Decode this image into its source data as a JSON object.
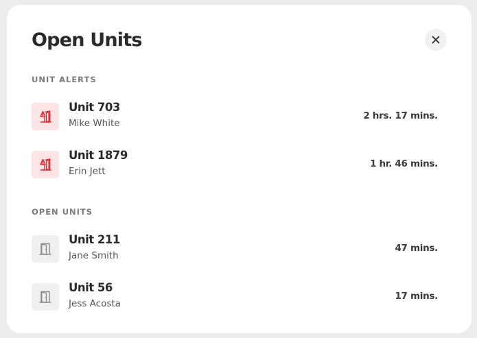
{
  "modal": {
    "title": "Open Units",
    "close_icon": "close-icon"
  },
  "sections": {
    "alerts": {
      "label": "UNIT ALERTS",
      "icon": "door-alert-icon",
      "accent_color": "#e0242e",
      "icon_background": "#fde3e3",
      "items": [
        {
          "unit": "Unit 703",
          "person": "Mike White",
          "duration": "2 hrs. 17 mins."
        },
        {
          "unit": "Unit 1879",
          "person": "Erin Jett",
          "duration": "1 hr. 46 mins."
        }
      ]
    },
    "open": {
      "label": "OPEN UNITS",
      "icon": "open-door-icon",
      "accent_color": "#8a8a8a",
      "icon_background": "#efefef",
      "items": [
        {
          "unit": "Unit 211",
          "person": "Jane Smith",
          "duration": "47 mins."
        },
        {
          "unit": "Unit 56",
          "person": "Jess Acosta",
          "duration": "17 mins."
        }
      ]
    }
  }
}
